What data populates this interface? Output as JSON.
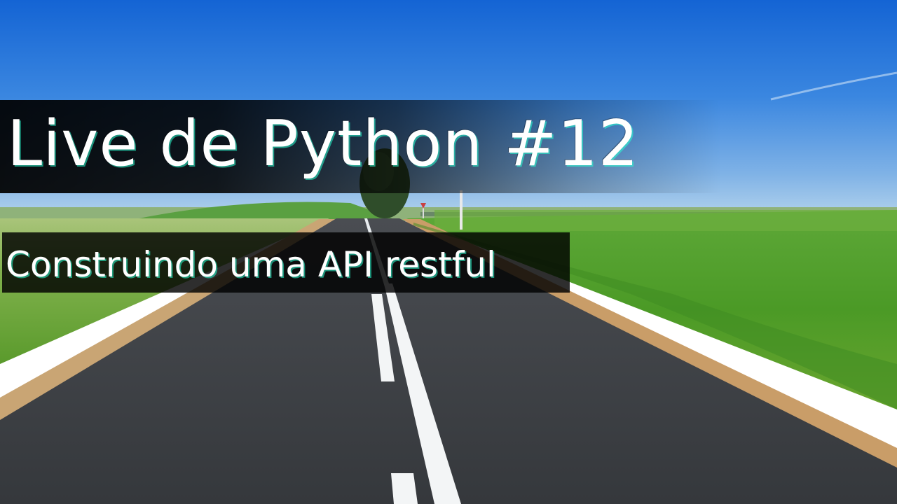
{
  "overlay": {
    "title": "Live de Python #12",
    "subtitle": "Construindo uma API restful"
  },
  "colors": {
    "sky_top": "#1565d6",
    "sky_horizon": "#a7cbe9",
    "grass": "#4f9f2a",
    "road": "#3e4145",
    "road_shoulder": "#caa070",
    "overlay_band": "#000000",
    "text": "#ffffff"
  }
}
